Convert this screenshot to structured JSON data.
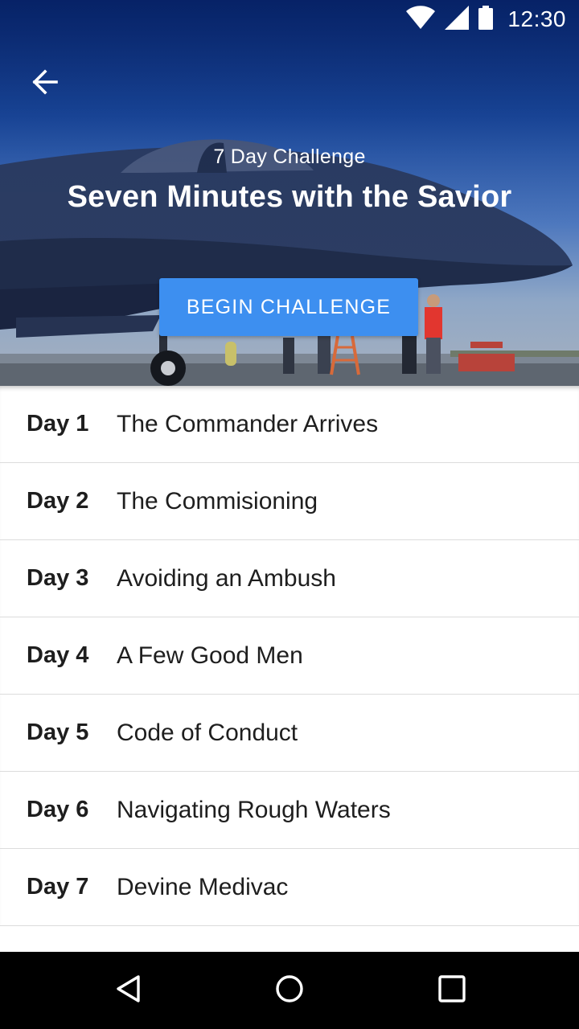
{
  "status_bar": {
    "time": "12:30",
    "icons": [
      "wifi-icon",
      "cell-signal-icon",
      "battery-icon"
    ]
  },
  "header": {
    "back_icon": "arrow-left-icon",
    "subtitle": "7 Day Challenge",
    "title": "Seven Minutes with the Savior",
    "begin_button_label": "BEGIN CHALLENGE"
  },
  "days": [
    {
      "label": "Day 1",
      "title": "The Commander Arrives"
    },
    {
      "label": "Day 2",
      "title": "The Commisioning"
    },
    {
      "label": "Day 3",
      "title": "Avoiding an Ambush"
    },
    {
      "label": "Day 4",
      "title": "A Few Good Men"
    },
    {
      "label": "Day 5",
      "title": "Code of Conduct"
    },
    {
      "label": "Day 6",
      "title": "Navigating Rough Waters"
    },
    {
      "label": "Day 7",
      "title": "Devine Medivac"
    }
  ],
  "nav_bar": {
    "icons": [
      "back-triangle-icon",
      "home-circle-icon",
      "recents-square-icon"
    ]
  },
  "colors": {
    "accent": "#3d8ff0",
    "text": "#1e1e1e",
    "divider": "#dcdcdc",
    "nav_bar": "#000000"
  }
}
